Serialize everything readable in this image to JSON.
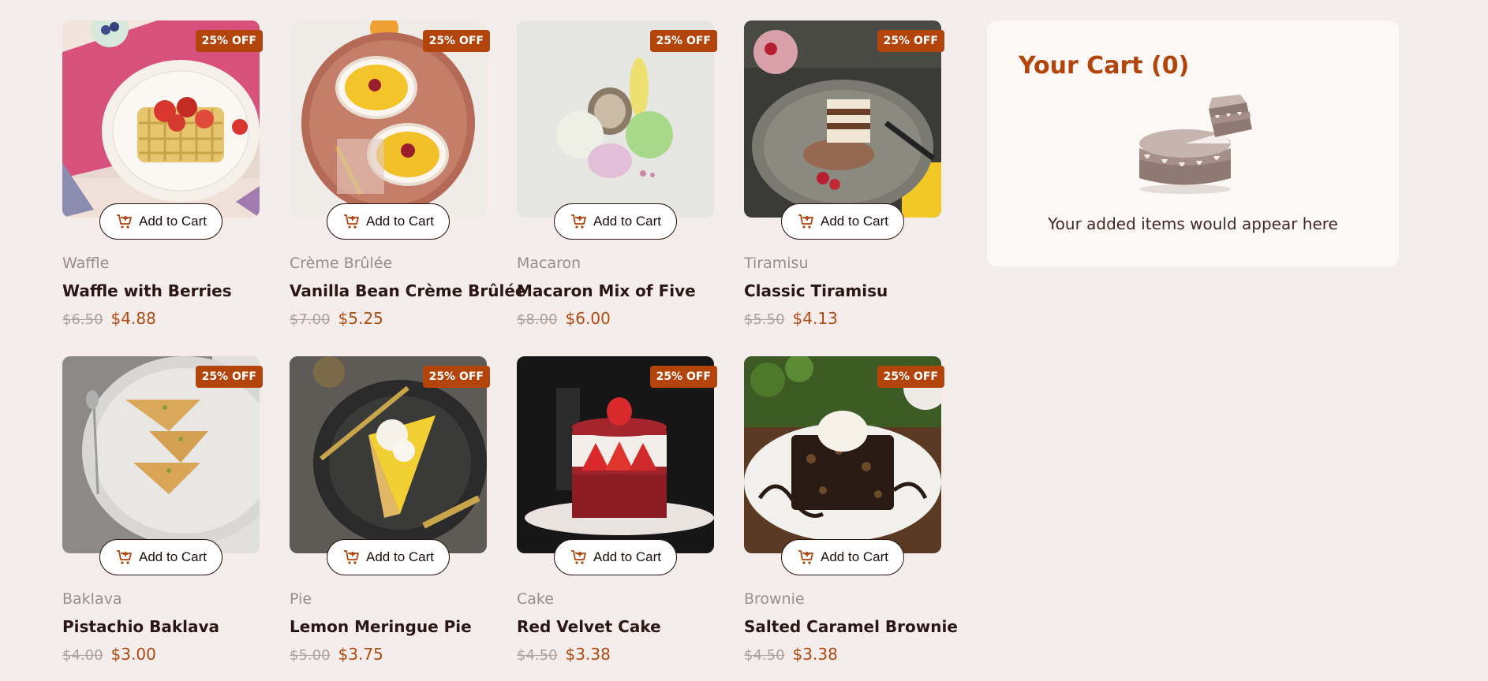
{
  "colors": {
    "background": "#f4edeb",
    "accent": "#b2440c",
    "price": "#b04a13",
    "cart_panel": "#fbf8f6"
  },
  "products": [
    {
      "category": "Waffle",
      "name": "Waffle with Berries",
      "old_price": "$6.50",
      "price": "$4.88",
      "badge": "25% OFF",
      "button": "Add to Cart",
      "image": "waffle-with-berries"
    },
    {
      "category": "Crème Brûlée",
      "name": "Vanilla Bean Crème Brûlée",
      "old_price": "$7.00",
      "price": "$5.25",
      "badge": "25% OFF",
      "button": "Add to Cart",
      "image": "creme-brulee"
    },
    {
      "category": "Macaron",
      "name": "Macaron Mix of Five",
      "old_price": "$8.00",
      "price": "$6.00",
      "badge": "25% OFF",
      "button": "Add to Cart",
      "image": "macarons"
    },
    {
      "category": "Tiramisu",
      "name": "Classic Tiramisu",
      "old_price": "$5.50",
      "price": "$4.13",
      "badge": "25% OFF",
      "button": "Add to Cart",
      "image": "tiramisu"
    },
    {
      "category": "Baklava",
      "name": "Pistachio Baklava",
      "old_price": "$4.00",
      "price": "$3.00",
      "badge": "25% OFF",
      "button": "Add to Cart",
      "image": "baklava"
    },
    {
      "category": "Pie",
      "name": "Lemon Meringue Pie",
      "old_price": "$5.00",
      "price": "$3.75",
      "badge": "25% OFF",
      "button": "Add to Cart",
      "image": "lemon-pie"
    },
    {
      "category": "Cake",
      "name": "Red Velvet Cake",
      "old_price": "$4.50",
      "price": "$3.38",
      "badge": "25% OFF",
      "button": "Add to Cart",
      "image": "red-velvet-cake"
    },
    {
      "category": "Brownie",
      "name": "Salted Caramel Brownie",
      "old_price": "$4.50",
      "price": "$3.38",
      "badge": "25% OFF",
      "button": "Add to Cart",
      "image": "brownie"
    }
  ],
  "cart": {
    "title": "Your Cart (0)",
    "empty_message": "Your added items would appear here",
    "illustration": "empty-cart-cake-icon"
  }
}
